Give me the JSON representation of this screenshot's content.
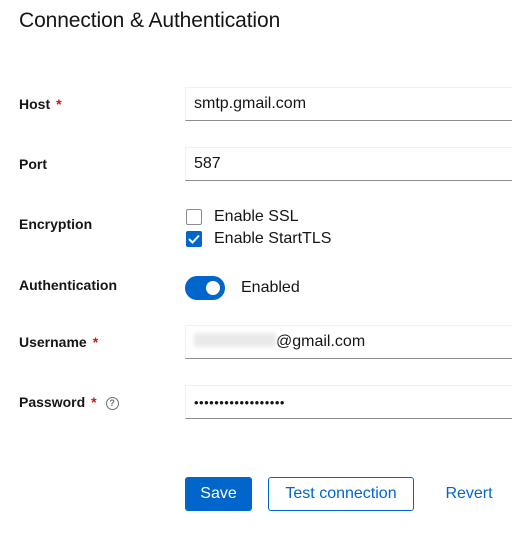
{
  "section": {
    "title": "Connection & Authentication"
  },
  "fields": {
    "host": {
      "label": "Host",
      "required_mark": "*",
      "value": "smtp.gmail.com"
    },
    "port": {
      "label": "Port",
      "value": "587"
    },
    "encryption": {
      "label": "Encryption",
      "options": [
        {
          "label": "Enable SSL",
          "checked": false
        },
        {
          "label": "Enable StartTLS",
          "checked": true
        }
      ]
    },
    "authentication": {
      "label": "Authentication",
      "toggle_on": true,
      "toggle_label": "Enabled"
    },
    "username": {
      "label": "Username",
      "required_mark": "*",
      "value_suffix": "@gmail.com"
    },
    "password": {
      "label": "Password",
      "required_mark": "*",
      "help_icon": "help-icon",
      "masked_value": "••••••••••••••••••"
    }
  },
  "actions": {
    "save": "Save",
    "test": "Test connection",
    "revert": "Revert"
  },
  "colors": {
    "primary": "#0066cc",
    "required": "#c9190b",
    "text": "#151515"
  }
}
